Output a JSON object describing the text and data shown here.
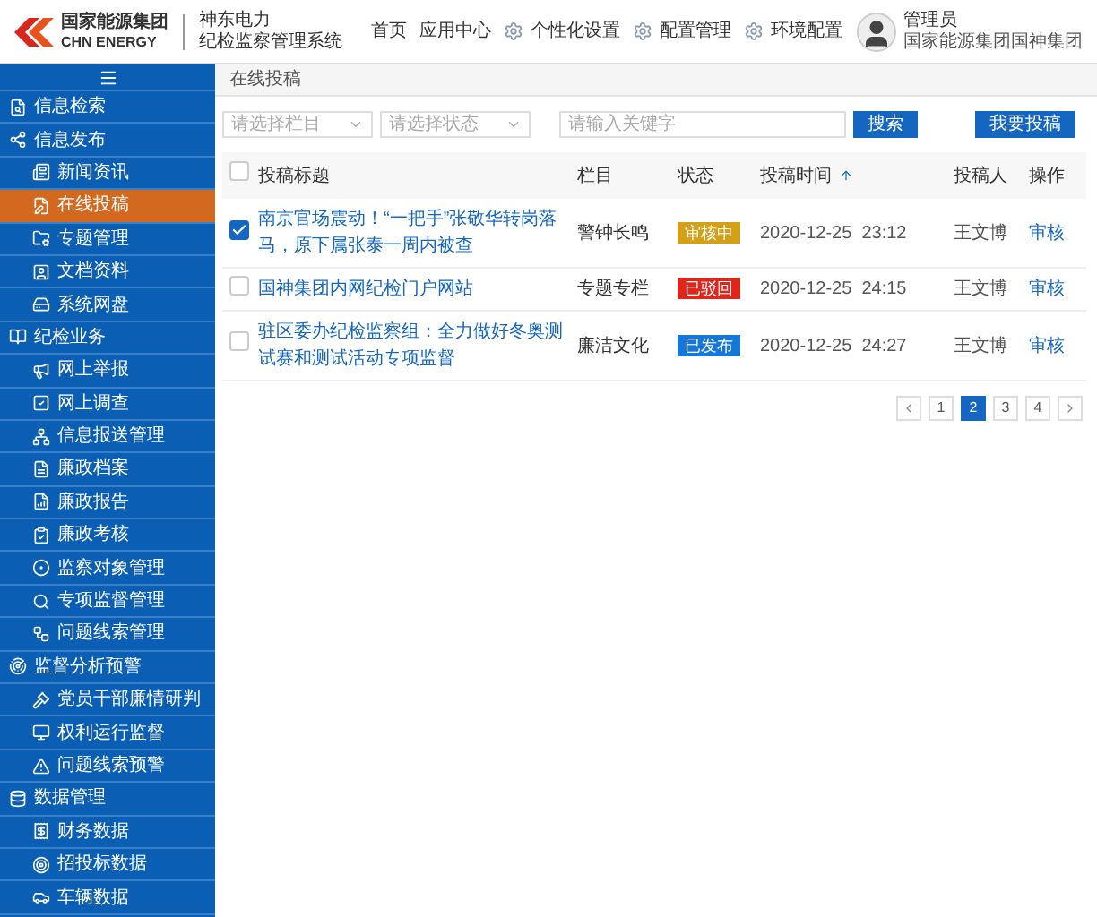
{
  "header": {
    "logo_name": "国家能源集团",
    "logo_en": "CHN ENERGY",
    "system_company": "神东电力",
    "system_name": "纪检监察管理系统",
    "nav": [
      {
        "label": "首页",
        "kind": "plain"
      },
      {
        "label": "应用中心",
        "kind": "plain"
      },
      {
        "label": "个性化设置",
        "kind": "gear"
      },
      {
        "label": "配置管理",
        "kind": "gear"
      },
      {
        "label": "环境配置",
        "kind": "gear"
      }
    ],
    "user": {
      "name": "管理员",
      "org": "国家能源集团国神集团"
    }
  },
  "sidebar": {
    "items": [
      {
        "label": "信息检索",
        "selected": false
      },
      {
        "label": "信息发布",
        "selected": false,
        "children": [
          {
            "label": "新闻资讯",
            "selected": false
          },
          {
            "label": "在线投稿",
            "selected": true
          },
          {
            "label": "专题管理",
            "selected": false
          },
          {
            "label": "文档资料",
            "selected": false
          },
          {
            "label": "系统网盘",
            "selected": false
          }
        ]
      },
      {
        "label": "纪检业务",
        "selected": false,
        "children": [
          {
            "label": "网上举报",
            "selected": false
          },
          {
            "label": "网上调查",
            "selected": false
          },
          {
            "label": "信息报送管理",
            "selected": false
          },
          {
            "label": "廉政档案",
            "selected": false
          },
          {
            "label": "廉政报告",
            "selected": false
          },
          {
            "label": "廉政考核",
            "selected": false
          },
          {
            "label": "监察对象管理",
            "selected": false
          },
          {
            "label": "专项监督管理",
            "selected": false
          },
          {
            "label": "问题线索管理",
            "selected": false
          }
        ]
      },
      {
        "label": "监督分析预警",
        "selected": false,
        "children": [
          {
            "label": "党员干部廉情研判",
            "selected": false
          },
          {
            "label": "权利运行监督",
            "selected": false
          },
          {
            "label": "问题线索预警",
            "selected": false
          }
        ]
      },
      {
        "label": "数据管理",
        "selected": false,
        "children": [
          {
            "label": "财务数据",
            "selected": false
          },
          {
            "label": "招投标数据",
            "selected": false
          },
          {
            "label": "车辆数据",
            "selected": false
          }
        ]
      }
    ]
  },
  "breadcrumb": "在线投稿",
  "filters": {
    "column_select": {
      "placeholder": "请选择栏目"
    },
    "status_select": {
      "placeholder": "请选择状态"
    },
    "search": {
      "placeholder": "请输入关键字"
    },
    "search_button": "搜索",
    "submit_button": "我要投稿"
  },
  "table": {
    "select_all": {
      "checked": false
    },
    "columns": [
      "投稿标题",
      "栏目",
      "状态",
      "投稿时间",
      "投稿人",
      "操作"
    ],
    "rows": [
      {
        "checked": true,
        "title": "南京官场震动！“一把手”张敬华转岗落马，原下属张泰一周内被查",
        "column": "警钟长鸣",
        "status": {
          "text": "审核中",
          "kind": "pending"
        },
        "time": "2020-12-25  23:12",
        "author": "王文博",
        "action": "审核"
      },
      {
        "checked": false,
        "title": "国神集团内网纪检门户网站",
        "column": "专题专栏",
        "status": {
          "text": "已驳回",
          "kind": "rejected"
        },
        "time": "2020-12-25  24:15",
        "author": "王文博",
        "action": "审核"
      },
      {
        "checked": false,
        "title": "驻区委办纪检监察组：全力做好冬奥测试赛和测试活动专项监督",
        "column": "廉洁文化",
        "status": {
          "text": "已发布",
          "kind": "published"
        },
        "time": "2020-12-25  24:27",
        "author": "王文博",
        "action": "审核"
      }
    ]
  },
  "pagination": {
    "pages": [
      {
        "label": "1",
        "selected": false
      },
      {
        "label": "2",
        "selected": true
      },
      {
        "label": "3",
        "selected": false
      },
      {
        "label": "4",
        "selected": false
      }
    ]
  }
}
